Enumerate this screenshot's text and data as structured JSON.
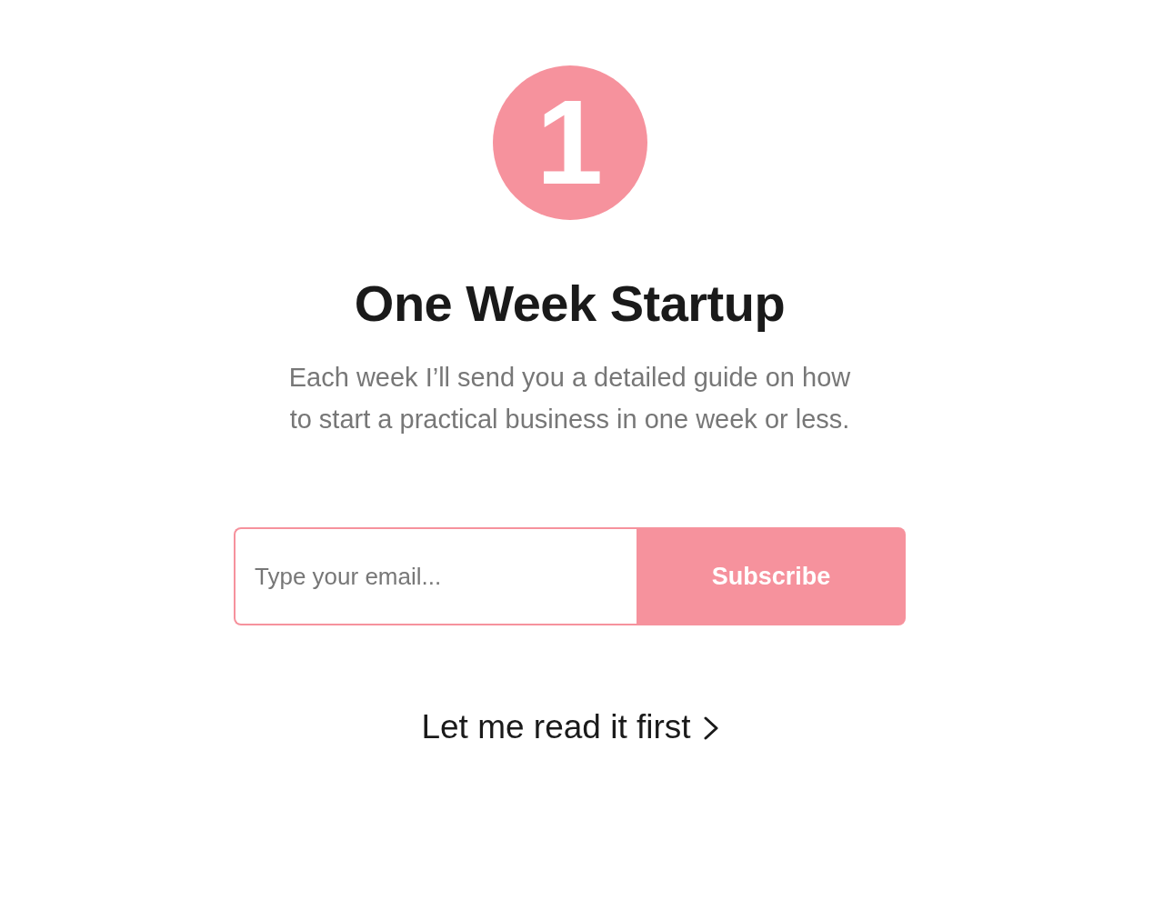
{
  "badge": {
    "text": "1"
  },
  "title": "One Week Startup",
  "description": "Each week I’ll send you a detailed guide on how to start a practical business in one week or less.",
  "signup_form": {
    "email_field": {
      "placeholder": "Type your email..."
    },
    "button": "Subscribe"
  },
  "link": {
    "label": "Let me read it first"
  }
}
